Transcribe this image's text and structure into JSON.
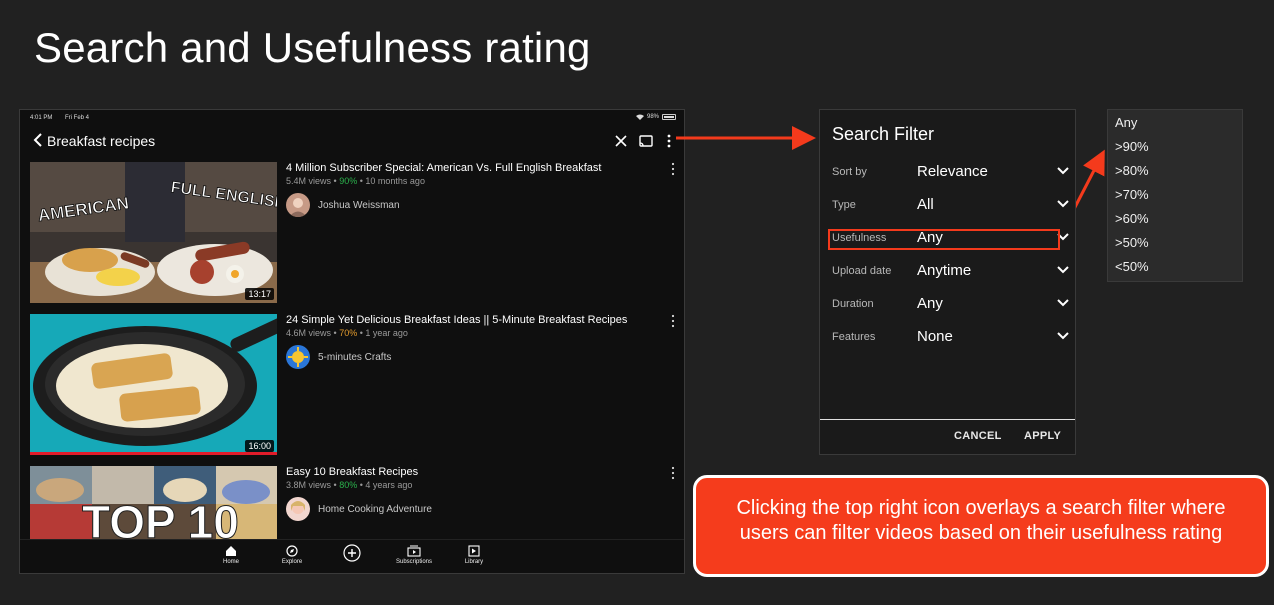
{
  "slide": {
    "title": "Search and Usefulness rating"
  },
  "phone": {
    "status": {
      "time": "4:01 PM",
      "date": "Fri Feb 4"
    },
    "search_query": "Breakfast recipes",
    "videos": [
      {
        "title": "4 Million Subscriber Special: American Vs. Full English Breakfast",
        "views": "5.4M views",
        "usefulness": "90%",
        "usefulness_color": "#2bb24c",
        "age": "10 months ago",
        "channel": "Joshua Weissman",
        "duration": "13:17",
        "thumb_text_left": "AMERICAN",
        "thumb_text_right": "FULL ENGLISH"
      },
      {
        "title": "24 Simple Yet Delicious Breakfast Ideas || 5-Minute Breakfast Recipes",
        "views": "4.6M views",
        "usefulness": "70%",
        "usefulness_color": "#e39b2c",
        "age": "1 year ago",
        "channel": "5-minutes Crafts",
        "duration": "16:00"
      },
      {
        "title": "Easy 10 Breakfast Recipes",
        "views": "3.8M views",
        "usefulness": "80%",
        "usefulness_color": "#2bb24c",
        "age": "4 years ago",
        "channel": "Home Cooking Adventure",
        "thumb_text": "TOP 10"
      }
    ],
    "separator": "•",
    "nav": [
      "Home",
      "Explore",
      "",
      "Subscriptions",
      "Library"
    ]
  },
  "filter": {
    "title": "Search Filter",
    "rows": [
      {
        "label": "Sort by",
        "value": "Relevance"
      },
      {
        "label": "Type",
        "value": "All"
      },
      {
        "label": "Usefulness",
        "value": "Any"
      },
      {
        "label": "Upload date",
        "value": "Anytime"
      },
      {
        "label": "Duration",
        "value": "Any"
      },
      {
        "label": "Features",
        "value": "None"
      }
    ],
    "cancel": "CANCEL",
    "apply": "APPLY"
  },
  "usefulness_options": [
    "Any",
    ">90%",
    ">80%",
    ">70%",
    ">60%",
    ">50%",
    "<50%"
  ],
  "callout": "Clicking the top right icon overlays a search filter where users can filter videos based on their usefulness rating",
  "colors": {
    "accent": "#f53c1c",
    "arrow": "#f43a1c"
  }
}
